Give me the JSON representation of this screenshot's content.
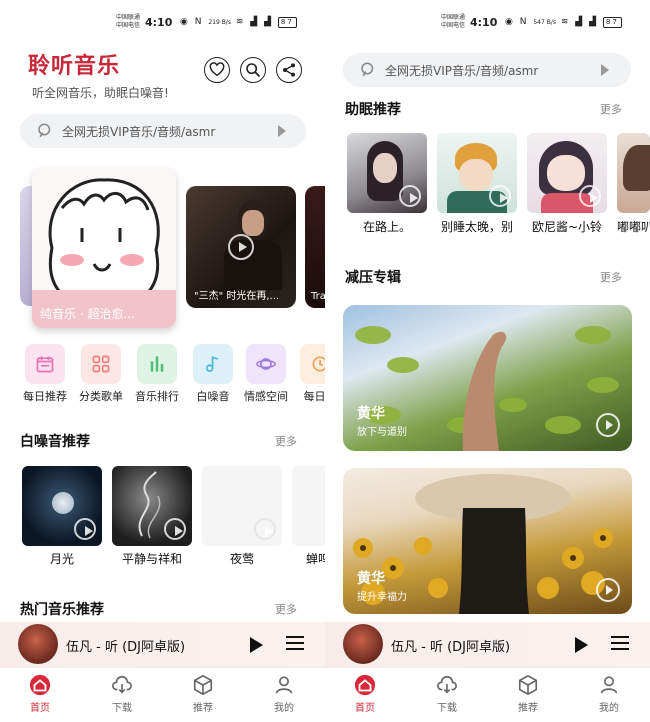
{
  "status": {
    "carrier1": "中国联通",
    "carrier2": "中国电信",
    "time": "4:10",
    "speed_left": "219 B/s",
    "speed_right": "547 B/s",
    "battery": "87"
  },
  "header": {
    "app_title": "聆听音乐",
    "subtitle": "听全网音乐，助眠白噪音!"
  },
  "search": {
    "placeholder": "全网无损VIP音乐/音频/asmr"
  },
  "banners": [
    {
      "caption": "纯音乐 · 超治愈..."
    },
    {
      "caption": "\"三杰\" 时光在再,..."
    },
    {
      "caption": "Tra"
    }
  ],
  "categories": [
    {
      "label": "每日推荐",
      "icon": "calendar-icon",
      "color": "#e86fb0"
    },
    {
      "label": "分类歌单",
      "icon": "grid-icon",
      "color": "#e8807e"
    },
    {
      "label": "音乐排行",
      "icon": "bar-chart-icon",
      "color": "#4fbf77"
    },
    {
      "label": "白噪音",
      "icon": "music-note-icon",
      "color": "#4db7d8"
    },
    {
      "label": "情感空间",
      "icon": "planet-icon",
      "color": "#a07ad8"
    },
    {
      "label": "每日洁",
      "icon": "clock-icon",
      "color": "#e8a25c"
    }
  ],
  "white_noise": {
    "title": "白噪音推荐",
    "more": "更多",
    "items": [
      {
        "label": "月光"
      },
      {
        "label": "平静与祥和"
      },
      {
        "label": "夜莺"
      },
      {
        "label": "蝉鸣"
      }
    ]
  },
  "hot_music": {
    "title": "热门音乐推荐",
    "more": "更多"
  },
  "sleep": {
    "title": "助眠推荐",
    "more": "更多",
    "items": [
      {
        "label": "在路上。"
      },
      {
        "label": "别睡太晚，别"
      },
      {
        "label": "欧尼酱~小铃"
      },
      {
        "label": "嘟嘟叭"
      }
    ]
  },
  "albums": {
    "title": "减压专辑",
    "more": "更多",
    "items": [
      {
        "title": "黄华",
        "subtitle": "放下与道别"
      },
      {
        "title": "黄华",
        "subtitle": "提升幸福力"
      }
    ]
  },
  "player": {
    "song": "伍凡 - 听 (DJ阿卓版)"
  },
  "tabs": [
    {
      "label": "首页",
      "icon": "home-icon",
      "active": true
    },
    {
      "label": "下载",
      "icon": "cloud-download-icon"
    },
    {
      "label": "推荐",
      "icon": "cube-icon"
    },
    {
      "label": "我的",
      "icon": "user-icon"
    }
  ],
  "colors": {
    "brand_red": "#c8293a",
    "tab_active": "#d8283a"
  }
}
